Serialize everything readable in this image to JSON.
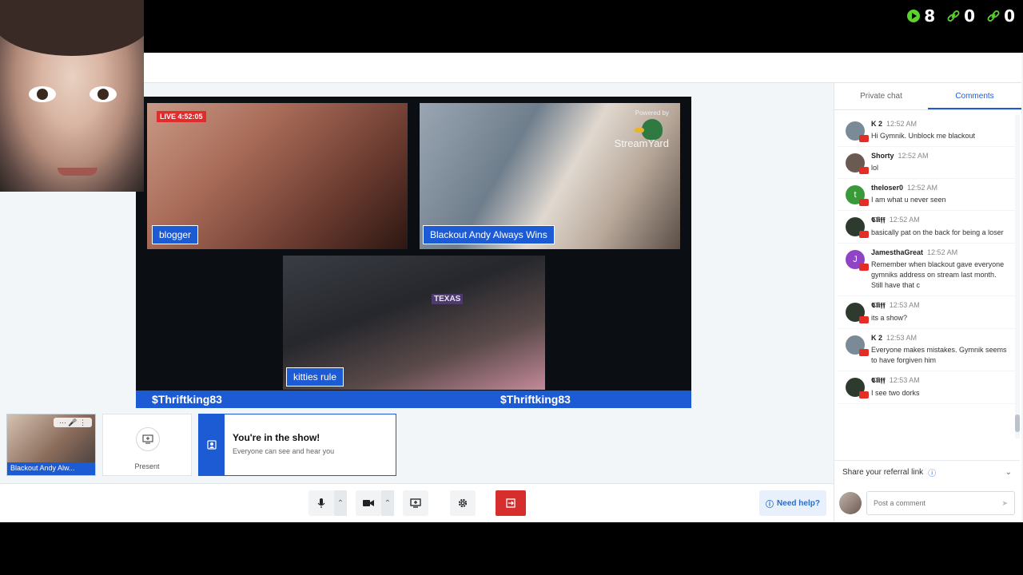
{
  "counters": [
    {
      "icon": "play-icon",
      "value": "8",
      "color": "#5bd32f"
    },
    {
      "icon": "link-icon",
      "value": "0",
      "color": "#5bd32f"
    },
    {
      "icon": "link-icon",
      "value": "0",
      "color": "#5bd32f"
    }
  ],
  "stage": {
    "live_badge": "LIVE 4:52:05",
    "tiles": [
      {
        "name": "blogger"
      },
      {
        "name": "Blackout Andy Always Wins"
      },
      {
        "name": "kitties rule"
      }
    ],
    "powered_by": "Powered by",
    "logo_text": "StreamYard",
    "tile3_sign": "TEXAS",
    "ticker_left": "$Thriftking83",
    "ticker_right": "$Thriftking83"
  },
  "bottom_row": {
    "thumb_label": "Blackout Andy Alw...",
    "present_label": "Present",
    "onshow_title": "You're in the show!",
    "onshow_sub": "Everyone can see and hear you"
  },
  "controls": {
    "help_label": "Need help?"
  },
  "panel": {
    "tabs": [
      "Private chat",
      "Comments"
    ],
    "active_tab": "Comments",
    "comments": [
      {
        "author": "K 2",
        "time": "12:52 AM",
        "text": "Hi Gymnik. Unblock me blackout",
        "avatar_color": "#7a8a96",
        "initial": ""
      },
      {
        "author": "Shorty",
        "time": "12:52 AM",
        "text": "lol",
        "avatar_color": "#6a5a52",
        "initial": ""
      },
      {
        "author": "theloser0",
        "time": "12:52 AM",
        "text": "I am what u never seen",
        "avatar_color": "#3a9a3a",
        "initial": "t"
      },
      {
        "author": "𝕮𝖑𝖎𝖋𝖋",
        "time": "12:52 AM",
        "text": "basically pat on the back for being a loser",
        "avatar_color": "#2e3a2e",
        "initial": ""
      },
      {
        "author": "JamesthaGreat",
        "time": "12:52 AM",
        "text": "Remember when blackout gave everyone gymniks address on stream last month. Still have that c",
        "avatar_color": "#8e44c4",
        "initial": "J"
      },
      {
        "author": "𝕮𝖑𝖎𝖋𝖋",
        "time": "12:53 AM",
        "text": "its a show?",
        "avatar_color": "#2e3a2e",
        "initial": ""
      },
      {
        "author": "K 2",
        "time": "12:53 AM",
        "text": "Everyone makes mistakes. Gymnik seems to have forgiven him",
        "avatar_color": "#7a8a96",
        "initial": ""
      },
      {
        "author": "𝕮𝖑𝖎𝖋𝖋",
        "time": "12:53 AM",
        "text": "I see two dorks",
        "avatar_color": "#2e3a2e",
        "initial": ""
      }
    ],
    "referral_label": "Share your referral link",
    "post_placeholder": "Post a comment"
  }
}
